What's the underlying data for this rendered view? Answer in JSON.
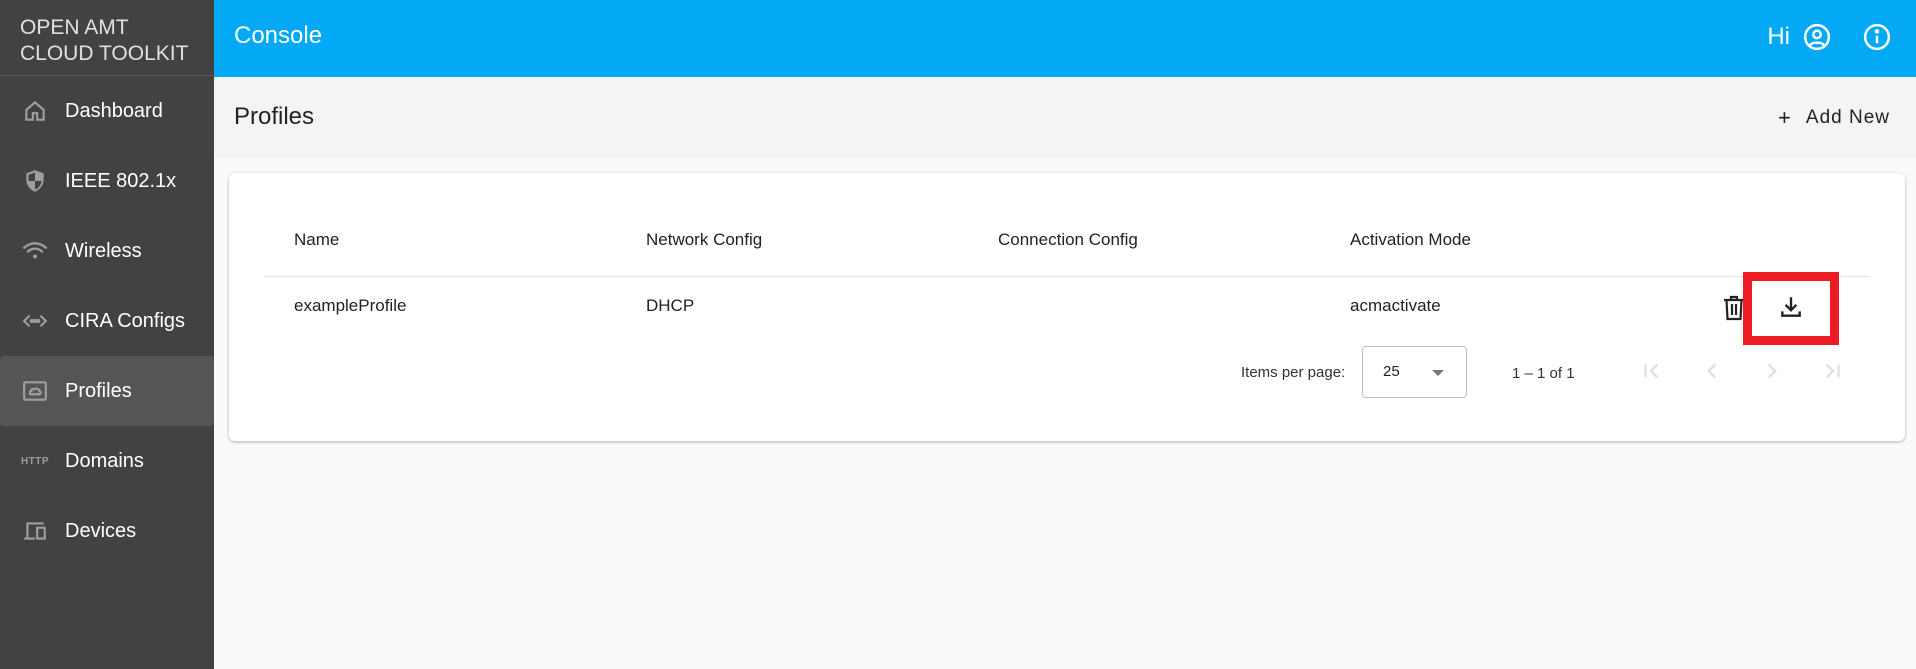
{
  "sidebar": {
    "brand_line1": "OPEN AMT",
    "brand_line2": "CLOUD TOOLKIT",
    "items": [
      {
        "label": "Dashboard",
        "icon": "home-icon",
        "active": false
      },
      {
        "label": "IEEE 802.1x",
        "icon": "shield-icon",
        "active": false
      },
      {
        "label": "Wireless",
        "icon": "wifi-icon",
        "active": false
      },
      {
        "label": "CIRA Configs",
        "icon": "settings-ethernet-icon",
        "active": false
      },
      {
        "label": "Profiles",
        "icon": "cloud-box-icon",
        "active": true
      },
      {
        "label": "Domains",
        "icon": "http-icon",
        "icon_text": "HTTP",
        "active": false
      },
      {
        "label": "Devices",
        "icon": "devices-icon",
        "active": false
      }
    ]
  },
  "topbar": {
    "title": "Console",
    "greeting": "Hi",
    "account_icon": "account-circle-icon",
    "info_icon": "info-icon",
    "background": "#03a9f4"
  },
  "page": {
    "title": "Profiles",
    "add_new_label": "Add New",
    "add_new_icon": "+"
  },
  "table": {
    "columns": [
      "Name",
      "Network Config",
      "Connection Config",
      "Activation Mode"
    ],
    "rows": [
      {
        "name": "exampleProfile",
        "network_config": "DHCP",
        "connection_config": "",
        "activation_mode": "acmactivate"
      }
    ]
  },
  "paginator": {
    "items_per_page_label": "Items per page:",
    "items_per_page_value": "25",
    "range_label": "1 – 1 of 1"
  },
  "highlight_color": "#ec1c24"
}
